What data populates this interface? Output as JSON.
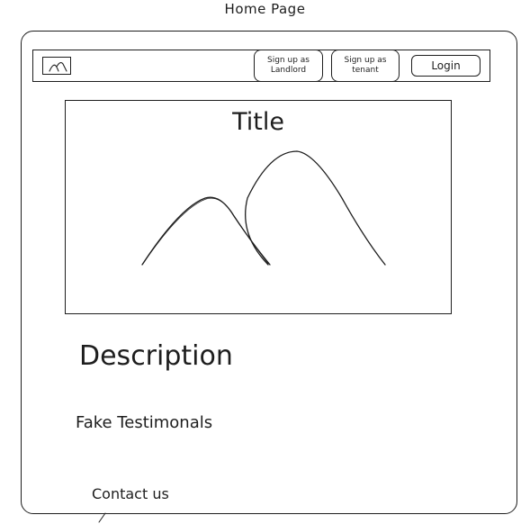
{
  "page_title": "Home Page",
  "navbar": {
    "logo_icon": "mountain-logo-icon",
    "buttons": {
      "signup_landlord": "Sign up as\nLandlord",
      "signup_tenant": "Sign up as\ntenant",
      "login": "Login"
    }
  },
  "hero": {
    "title": "Title",
    "image_icon": "mountain-image-placeholder"
  },
  "sections": {
    "description": "Description",
    "testimonials": "Fake Testimonals",
    "contact": "Contact us"
  },
  "colors": {
    "stroke": "#1e1e1e",
    "background": "#ffffff"
  }
}
